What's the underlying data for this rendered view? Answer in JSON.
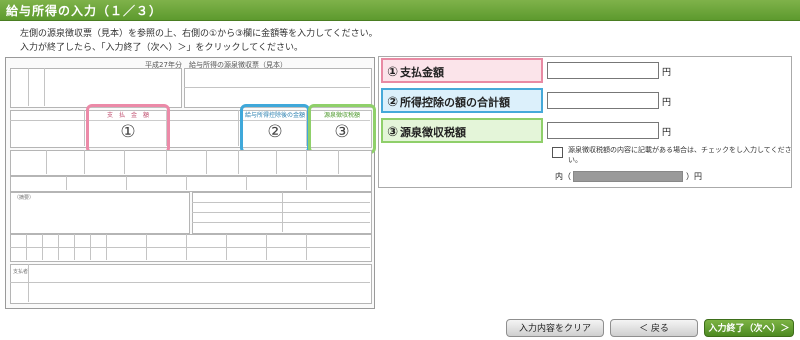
{
  "header": {
    "title": "給与所得の入力（１／３）"
  },
  "instructions": {
    "line1": "左側の源泉徴収票（見本）を参照の上、右側の①から③欄に金額等を入力してください。",
    "line2": "入力が終了したら、「入力終了（次へ）＞」をクリックしてください。"
  },
  "slip": {
    "title": "平成27年分　給与所得の源泉徴収票（見本）",
    "marker1_label": "支　払　金　額",
    "marker1_num": "①",
    "marker2_label": "給与所得控除後の金額",
    "marker2_num": "②",
    "marker3_label": "源泉徴収税額",
    "marker3_num": "③",
    "small_label_remarks": "（摘要）",
    "small_label_payer": "支払者"
  },
  "form": {
    "row1": {
      "num": "①",
      "label": "支払金額",
      "unit": "円",
      "value": ""
    },
    "row2": {
      "num": "②",
      "label": "所得控除の額の合計額",
      "unit": "円",
      "value": ""
    },
    "row3": {
      "num": "③",
      "label": "源泉徴収税額",
      "unit": "円",
      "value": "",
      "note": "源泉徴収税額の内容に記載がある場合は、チェックをし入力してください。",
      "sub_prefix": "内（",
      "sub_suffix": "）円"
    }
  },
  "buttons": {
    "clear": "入力内容をクリア",
    "back": "＜ 戻る",
    "next": "入力終了（次へ）＞"
  },
  "colors": {
    "header_green": "#6aa539",
    "row1_bg": "#fbe4ea",
    "row1_border": "#e88aa3",
    "row2_bg": "#dcf0fb",
    "row2_border": "#46a9d9",
    "row3_bg": "#e4f5d9",
    "row3_border": "#8fcf6a"
  }
}
